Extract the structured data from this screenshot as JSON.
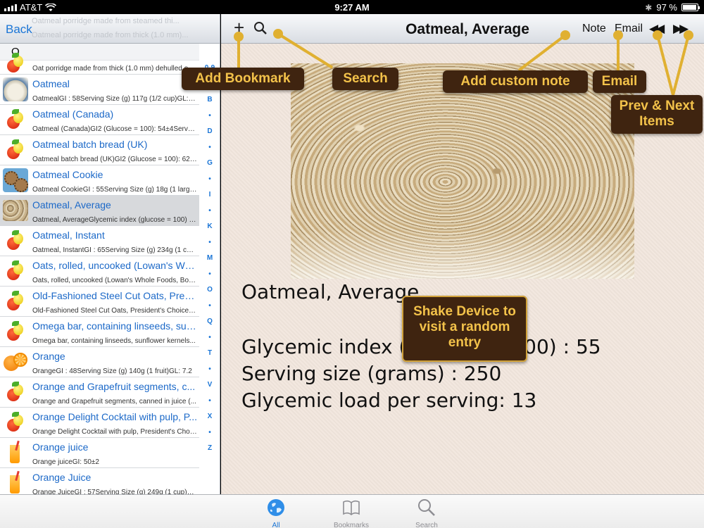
{
  "status": {
    "carrier": "AT&T",
    "time": "9:27 AM",
    "battery": "97 %",
    "battery_level": 0.97
  },
  "master": {
    "back_label": "Back",
    "ghost_rows": [
      "Oatmeal porridge made from steamed thi...",
      "Oatmeal porridge made from thick (1.0 mm)..."
    ],
    "section_letter": "O",
    "partial_row_sub": "Oat porridge made from thick (1.0 mm) dehulled oat...",
    "items": [
      {
        "title": "Oatmeal",
        "sub": "OatmealGI : 58Serving Size (g) 117g (1/2 cup)GL: 6.4",
        "thumb": "bowl"
      },
      {
        "title": "Oatmeal (Canada)",
        "sub": "Oatmeal (Canada)GI2 (Glucose = 100): 54±4Serve...",
        "thumb": "apple"
      },
      {
        "title": "Oatmeal batch bread (UK)",
        "sub": "Oatmeal batch bread (UK)GI2 (Glucose = 100): 62±...",
        "thumb": "apple"
      },
      {
        "title": "Oatmeal Cookie",
        "sub": "Oatmeal CookieGI : 55Serving Size (g) 18g (1 large...",
        "thumb": "cookie"
      },
      {
        "title": "Oatmeal, Average",
        "sub": "Oatmeal, AverageGlycemic index (glucose = 100) : ...",
        "thumb": "oats"
      },
      {
        "title": "Oatmeal, Instant",
        "sub": "Oatmeal, InstantGI : 65Serving Size (g) 234g (1 cup...",
        "thumb": "apple"
      },
      {
        "title": "Oats, rolled, uncooked (Lowan's Wh...",
        "sub": "Oats, rolled, uncooked (Lowan's Whole Foods, Box...",
        "thumb": "apple"
      },
      {
        "title": "Old-Fashioned Steel Cut Oats, Presi...",
        "sub": "Old-Fashioned Steel Cut Oats, President's Choice®...",
        "thumb": "apple"
      },
      {
        "title": "Omega bar, containing linseeds, sun...",
        "sub": "Omega bar, containing linseeds, sunflower kernels...",
        "thumb": "apple"
      },
      {
        "title": "Orange",
        "sub": "OrangeGI : 48Serving Size (g) 140g (1 fruit)GL: 7.2",
        "thumb": "orange"
      },
      {
        "title": "Orange and Grapefruit segments, c...",
        "sub": "Orange and Grapefruit segments, canned in juice (...",
        "thumb": "apple"
      },
      {
        "title": "Orange Delight Cocktail with pulp, P...",
        "sub": "Orange Delight Cocktail with pulp, President's Choic...",
        "thumb": "apple"
      },
      {
        "title": "Orange juice",
        "sub": "Orange juiceGI: 50±2",
        "thumb": "juice"
      },
      {
        "title": "Orange Juice",
        "sub": "Orange JuiceGI : 57Serving Size (g) 249g (1 cup)G...",
        "thumb": "juice"
      }
    ],
    "index_letters": [
      "0-9",
      "•",
      "B",
      "•",
      "D",
      "•",
      "G",
      "•",
      "I",
      "•",
      "K",
      "•",
      "M",
      "•",
      "O",
      "•",
      "Q",
      "•",
      "T",
      "•",
      "V",
      "•",
      "X",
      "•",
      "Z"
    ]
  },
  "detail": {
    "nav_title": "Oatmeal, Average",
    "plus_glyph": "+",
    "note_label": "Note",
    "email_label": "Email",
    "prev_glyph": "◀◀",
    "next_glyph": "▶▶",
    "name": "Oatmeal, Average",
    "gi_line": "Glycemic index (glucose = 100) : 55",
    "serving_line": "Serving size (grams) : 250",
    "gl_line": "Glycemic load per serving: 13"
  },
  "callouts": {
    "add_bookmark": "Add Bookmark",
    "search": "Search",
    "add_note": "Add custom note",
    "email": "Email",
    "prev_next": "Prev & Next Items",
    "shake": "Shake Device to visit a random entry"
  },
  "tabs": [
    {
      "label": "All",
      "icon": "globe-icon"
    },
    {
      "label": "Bookmarks",
      "icon": "book-icon"
    },
    {
      "label": "Search",
      "icon": "search-icon"
    }
  ],
  "colors": {
    "accent": "#1a75d6",
    "callout_bg": "#3f2410",
    "callout_text": "#f3c24a",
    "pointer": "#e0b031"
  }
}
